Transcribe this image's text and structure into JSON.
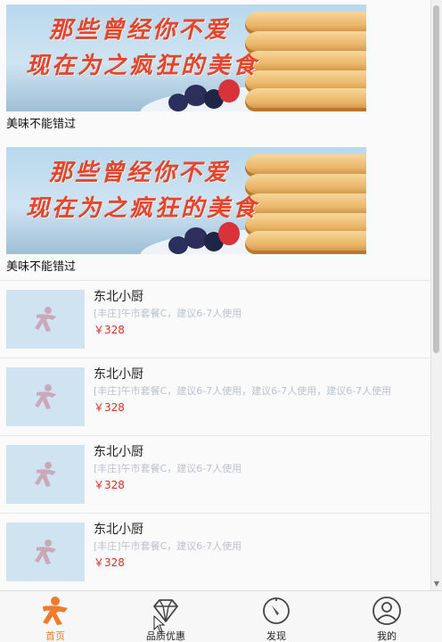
{
  "banners": [
    {
      "line1": "那些曾经你不爱",
      "line2": "现在为之疯狂的美食",
      "caption": "美味不能错过"
    },
    {
      "line1": "那些曾经你不爱",
      "line2": "现在为之疯狂的美食",
      "caption": "美味不能错过"
    }
  ],
  "items": [
    {
      "title": "东北小厨",
      "desc": "[丰庄]午市套餐C，建议6-7人使用",
      "price": "￥328"
    },
    {
      "title": "东北小厨",
      "desc": "[丰庄]午市套餐C，建议6-7人使用，建议6-7人使用，建议6-7人使用",
      "price": "￥328"
    },
    {
      "title": "东北小厨",
      "desc": "[丰庄]午市套餐C，建议6-7人使用",
      "price": "￥328"
    },
    {
      "title": "东北小厨",
      "desc": "[丰庄]午市套餐C，建议6-7人使用",
      "price": "￥328"
    }
  ],
  "tabs": [
    {
      "label": "首页",
      "icon": "home-person-icon",
      "active": true
    },
    {
      "label": "品质优惠",
      "icon": "diamond-icon",
      "active": false
    },
    {
      "label": "发现",
      "icon": "compass-icon",
      "active": false
    },
    {
      "label": "我的",
      "icon": "user-icon",
      "active": false
    }
  ],
  "colors": {
    "accent": "#f07b2a",
    "price": "#e02e24",
    "banner_text": "#e8432b",
    "desc": "#b9c3cf"
  }
}
